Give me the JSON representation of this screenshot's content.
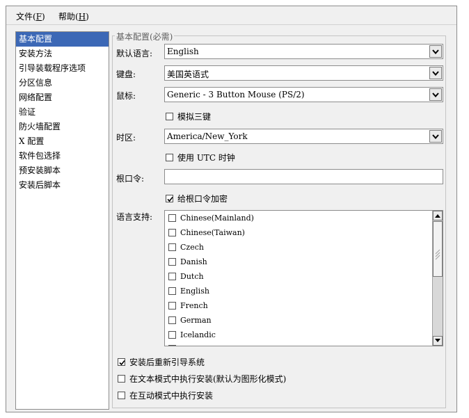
{
  "menu": {
    "file": {
      "label": "文件(",
      "mnemonic": "F",
      "suffix": ")"
    },
    "help": {
      "label": "帮助(",
      "mnemonic": "H",
      "suffix": ")"
    }
  },
  "sidebar": {
    "items": [
      {
        "label": "基本配置",
        "selected": true
      },
      {
        "label": "安装方法"
      },
      {
        "label": "引导装载程序选项"
      },
      {
        "label": "分区信息"
      },
      {
        "label": "网络配置"
      },
      {
        "label": "验证"
      },
      {
        "label": "防火墙配置"
      },
      {
        "label": "X 配置"
      },
      {
        "label": "软件包选择"
      },
      {
        "label": "预安装脚本"
      },
      {
        "label": "安装后脚本"
      }
    ]
  },
  "basic": {
    "group_title": "基本配置(必需)",
    "language_label": "默认语言:",
    "language_value": "English",
    "keyboard_label": "键盘:",
    "keyboard_value": "美国英语式",
    "mouse_label": "鼠标:",
    "mouse_value": "Generic - 3 Button Mouse (PS/2)",
    "emulate3_label": "模拟三键",
    "emulate3_checked": false,
    "timezone_label": "时区:",
    "timezone_value": "America/New_York",
    "utc_label": "使用 UTC 时钟",
    "utc_checked": false,
    "rootpw_label": "根口令:",
    "rootpw_value": "",
    "encrypt_label": "给根口令加密",
    "encrypt_checked": true,
    "langsupport_label": "语言支持:",
    "languages": [
      {
        "label": "Chinese(Mainland)",
        "checked": false
      },
      {
        "label": "Chinese(Taiwan)",
        "checked": false
      },
      {
        "label": "Czech",
        "checked": false
      },
      {
        "label": "Danish",
        "checked": false
      },
      {
        "label": "Dutch",
        "checked": false
      },
      {
        "label": "English",
        "checked": false
      },
      {
        "label": "French",
        "checked": false
      },
      {
        "label": "German",
        "checked": false
      },
      {
        "label": "Icelandic",
        "checked": false
      }
    ],
    "reboot_label": "安装后重新引导系统",
    "reboot_checked": true,
    "textmode_label": "在文本模式中执行安装(默认为图形化模式)",
    "textmode_checked": false,
    "interactive_label": "在互动模式中执行安装",
    "interactive_checked": false
  },
  "colors": {
    "selection": "#3c68b6",
    "window_bg": "#f0f0f0"
  }
}
